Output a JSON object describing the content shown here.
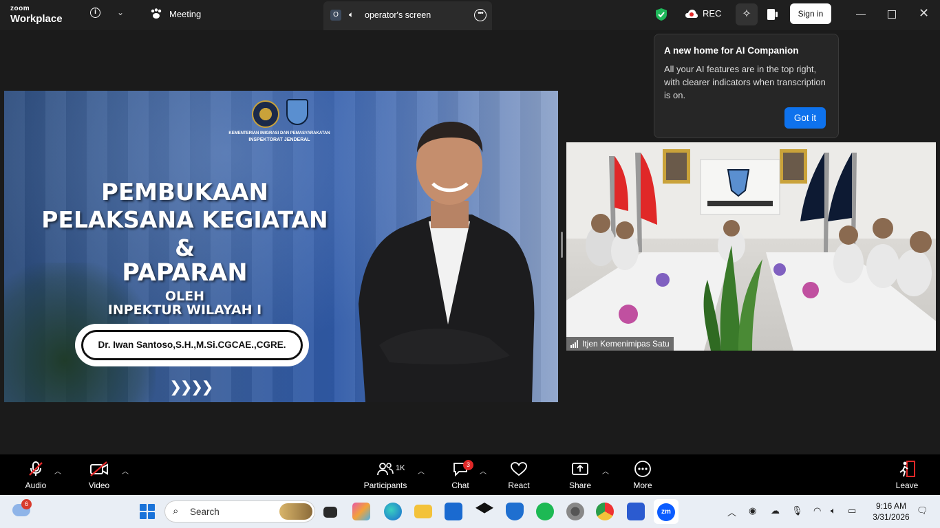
{
  "app": {
    "logo_top": "zoom",
    "logo_bottom": "Workplace"
  },
  "tabs": {
    "meeting": "Meeting",
    "screen_tab_letter": "O",
    "screen_tab": "operator's screen"
  },
  "header": {
    "rec": "REC",
    "sign_in": "Sign in"
  },
  "tooltip": {
    "title": "A new home for AI Companion",
    "body": "All your AI features are in the top right, with clearer indicators when transcription is on.",
    "button": "Got it"
  },
  "slide": {
    "ministry": "KEMENTERIAN IMIGRASI DAN PEMASYARAKATAN",
    "unit": "INSPEKTORAT JENDERAL",
    "line1": "PEMBUKAAN",
    "line2": "PELAKSANA KEGIATAN",
    "line3": "&",
    "line4": "PAPARAN",
    "line5": "OLEH",
    "line6": "INPEKTUR WILAYAH I",
    "speaker_name": "Dr. Iwan Santoso,S.H.,M.Si.CGCAE.,CGRE.",
    "arrows": "❯❯❯❯"
  },
  "camera": {
    "participant_name": "Itjen Kemenimipas Satu"
  },
  "toolbar": {
    "audio": "Audio",
    "video": "Video",
    "participants": "Participants",
    "participants_count": "1K",
    "chat": "Chat",
    "chat_badge": "3",
    "react": "React",
    "share": "Share",
    "more": "More",
    "leave": "Leave"
  },
  "taskbar": {
    "weather_badge": "6",
    "search_placeholder": "Search",
    "time": "9:16 AM",
    "date": "3/31/2026"
  },
  "colors": {
    "accent_blue": "#0e72ed",
    "badge_red": "#e02828",
    "leave_red": "#e02828"
  }
}
